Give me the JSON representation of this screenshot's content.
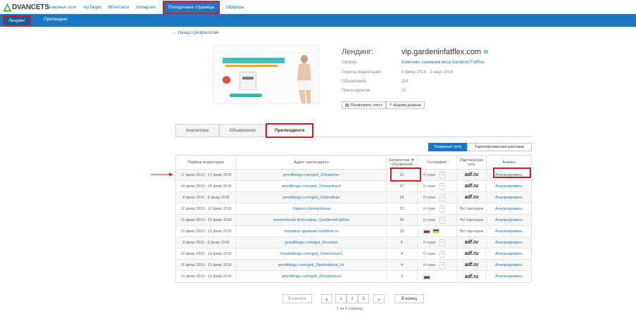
{
  "brand": {
    "logo_text": "DVANCETS",
    "logo_letter": "A"
  },
  "nav": {
    "items": [
      "Тизерные сети",
      "myTarget",
      "ВКонтакте",
      "Instagram",
      "Посадочные страницы",
      "Офферы"
    ],
    "active": "Посадочные страницы"
  },
  "subnav": {
    "items": [
      "Лендинг",
      "Прелендинг"
    ],
    "active": "Лендинг"
  },
  "back_link": "← Назад к результатам",
  "landing": {
    "title": "Лендинг:",
    "url": "vip.gardeninfatflex.com",
    "offer_label": "Оффер:",
    "offer_value": "Комплекс снижения веса Gardenin FatFlex",
    "period_label": "Период индексации:",
    "period_value": "6 февр 2018 - 2 март 2018",
    "ads_label": "Объявлений:",
    "ads_value": "118",
    "prelandings_label": "Прелендингов:",
    "prelandings_value": "23"
  },
  "actions": {
    "view_text": "Посмотреть текст",
    "analyze_domain": "Анализ домена"
  },
  "tabs": [
    "Аналитика",
    "Объявления",
    "Прелендинги"
  ],
  "active_tab": "Прелендинги",
  "filters": {
    "teaser": "Тизерные сети",
    "targeted": "Таргетированная реклама"
  },
  "table": {
    "headers": {
      "period": "Период индексации",
      "address": "Адрес прелендинга",
      "count": "Количество ▼ объявлений",
      "geo": "География",
      "partner": "Партнерская сеть",
      "analysis": "Анализ"
    },
    "rows": [
      {
        "period": "17 февр 2018 - 17 февр 2018",
        "url": "proofblogs.com/grd_2/malahov",
        "count": "31",
        "geo": "4 стран",
        "geo_type": "text",
        "partner": "adf.ru",
        "action": "Анализировать"
      },
      {
        "period": "14 февр 2018 - 14 февр 2018",
        "url": "proofblogs.com/grd_2/minzdrav2",
        "count": "37",
        "geo": "6 стран",
        "geo_type": "text",
        "partner": "adf.ru",
        "action": "Анализировать"
      },
      {
        "period": "8 февр 2018 - 8 февр 2018",
        "url": "proofblogs.com/grd_2/minzdrav",
        "count": "34",
        "geo": "6 стран",
        "geo_type": "text",
        "partner": "adf.ru",
        "action": "Анализировать"
      },
      {
        "period": "12 февр 2018 - 12 февр 2018",
        "url": "7dayuru.lt/melysheva",
        "count": "21",
        "geo": "4 стран",
        "geo_type": "text",
        "partner": "Нет партнерки",
        "action": "Анализировать"
      },
      {
        "period": "15 февр 2018 - 15 февр 2018",
        "url": "runewsheals.lt/minzdrav_GardeninFatFlex",
        "count": "20",
        "geo": "6 стран",
        "geo_type": "text",
        "partner": "Нет партнерки",
        "action": "Анализировать"
      },
      {
        "period": "13 февр 2018 - 13 февр 2018",
        "url": "minzdrav-gardenin.ladsfore.ru",
        "count": "10",
        "geo": "",
        "geo_type": "flags_ru_ua",
        "partner": "Нет партнерки",
        "action": "Анализировать"
      },
      {
        "period": "8 февр 2018 - 8 февр 2018",
        "url": "proofblogs.com/grd_2/cosmo",
        "count": "5",
        "geo": "4 стран",
        "geo_type": "text",
        "partner": "adf.ru",
        "action": "Анализировать"
      },
      {
        "period": "13 февр 2018 - 13 февр 2018",
        "url": "lnxatelblogs.com/grd_2/minzdrav2",
        "count": "4",
        "geo": "6 стран",
        "geo_type": "text",
        "partner": "adf.ru",
        "action": "Анализировать"
      },
      {
        "period": "15 февр 2018 - 15 февр 2018",
        "url": "proofblogs.com/grd_2/pohudenie_kz",
        "count": "4",
        "geo": "4 стран",
        "geo_type": "text",
        "partner": "adf.ru",
        "action": "Анализировать"
      },
      {
        "period": "13 февр 2018 - 13 февр 2018",
        "url": "proofblogs.com/grd_2/malisheva",
        "count": "3",
        "geo": "",
        "geo_type": "flags_ru",
        "partner": "adf.ru",
        "action": "Анализировать"
      }
    ]
  },
  "pagination": {
    "first": "В начало",
    "prev": "‹",
    "pages": [
      "1",
      "2",
      "3"
    ],
    "next": "›",
    "last": "В конец",
    "info": "1 из 3 страниц"
  },
  "colors": {
    "accent": "#1a78c2",
    "highlight": "#d21f26",
    "link": "#1f6fa8"
  }
}
